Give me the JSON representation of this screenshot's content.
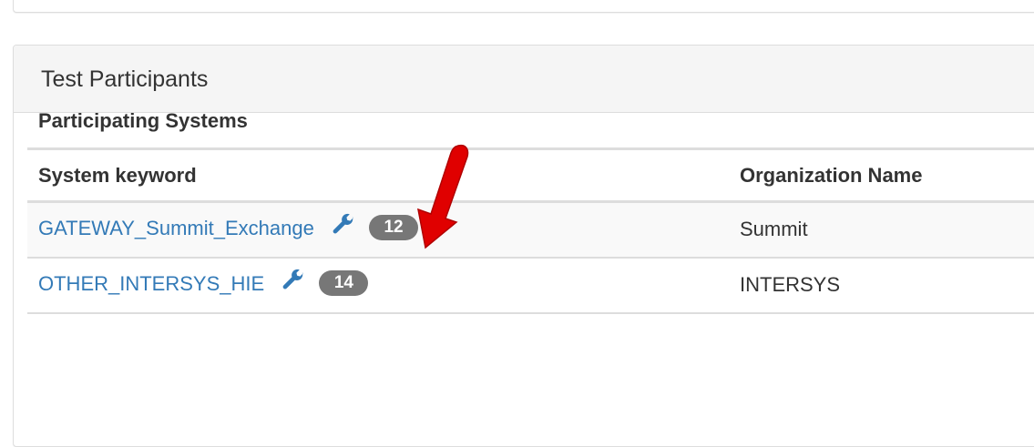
{
  "panel": {
    "title": "Test Participants"
  },
  "section": {
    "title": "Participating Systems"
  },
  "table": {
    "headers": {
      "system_keyword": "System keyword",
      "organization_name": "Organization Name"
    },
    "rows": [
      {
        "system_keyword": "GATEWAY_Summit_Exchange",
        "count": "12",
        "organization": "Summit"
      },
      {
        "system_keyword": "OTHER_INTERSYS_HIE",
        "count": "14",
        "organization": "INTERSYS"
      }
    ]
  },
  "colors": {
    "link": "#337ab7",
    "badge": "#777777",
    "annotation_arrow": "#e00000"
  },
  "icons": {
    "row_action": "wrench-icon",
    "annotation": "red-arrow-annotation"
  }
}
